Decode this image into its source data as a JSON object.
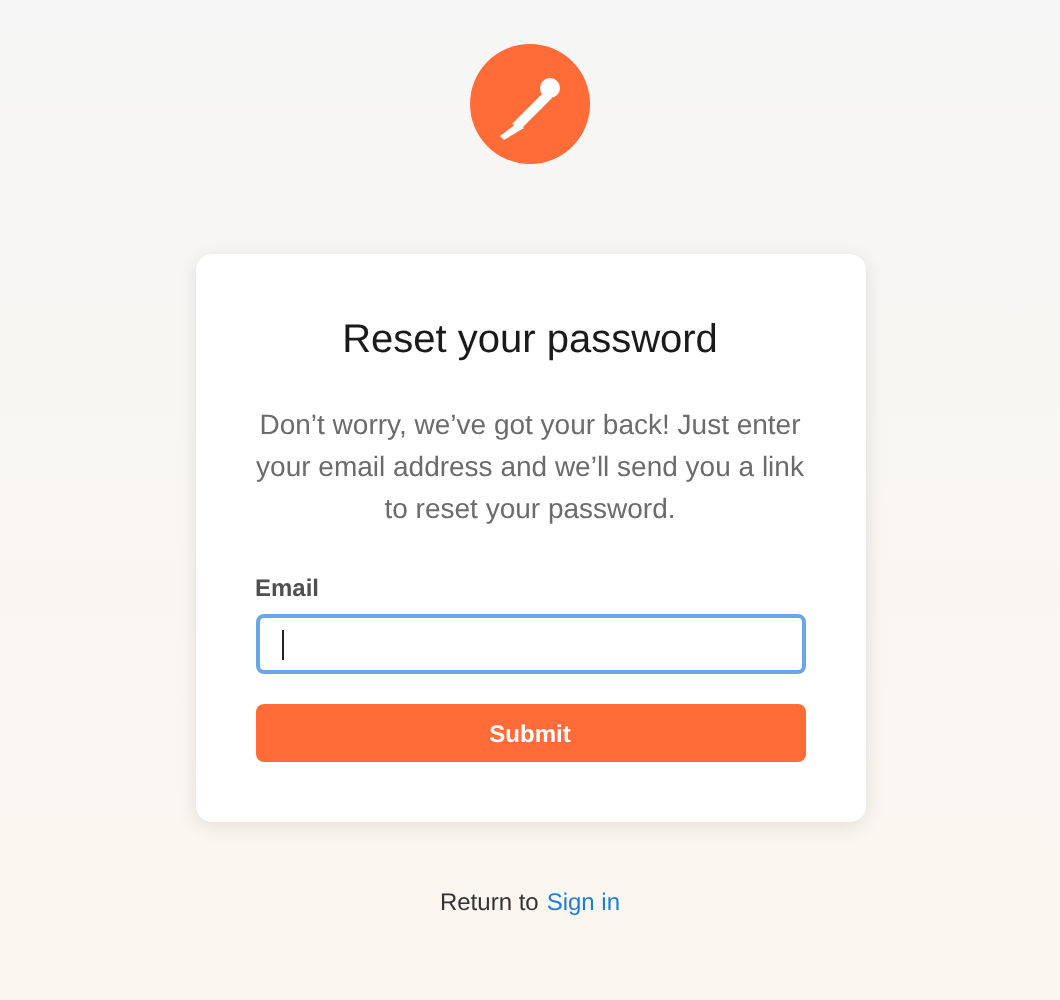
{
  "card": {
    "title": "Reset your password",
    "description": "Don’t worry, we’ve got your back! Just enter your email address and we’ll send you a link to reset your password.",
    "email_field": {
      "label": "Email",
      "focused": true
    },
    "submit_button": "Submit"
  },
  "footer": {
    "text": "Return to",
    "link": "Sign in"
  }
}
